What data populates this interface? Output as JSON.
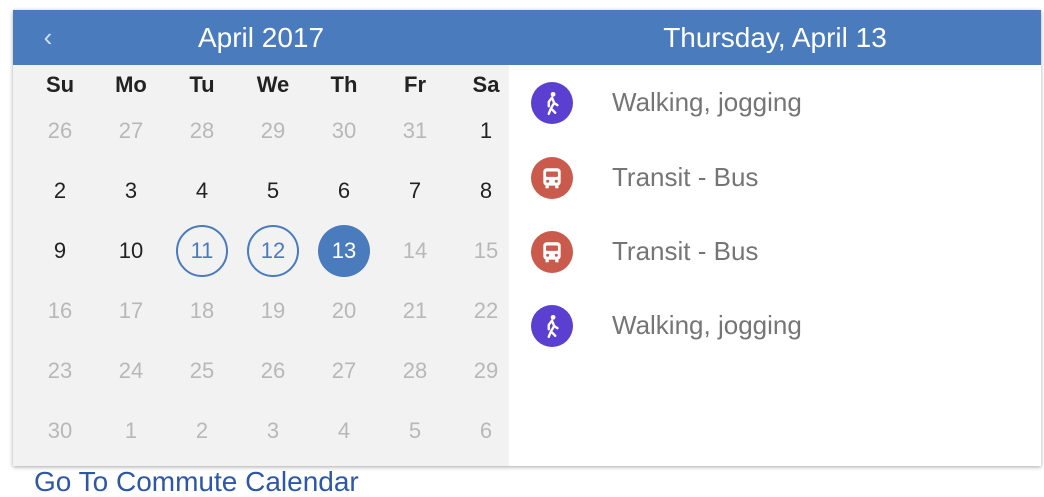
{
  "calendar": {
    "prev_icon": "chevron-left-icon",
    "month_title": "April 2017",
    "weekday_labels": [
      "Su",
      "Mo",
      "Tu",
      "We",
      "Th",
      "Fr",
      "Sa"
    ],
    "days": [
      {
        "label": "26",
        "state": "other"
      },
      {
        "label": "27",
        "state": "other"
      },
      {
        "label": "28",
        "state": "other"
      },
      {
        "label": "29",
        "state": "other"
      },
      {
        "label": "30",
        "state": "other"
      },
      {
        "label": "31",
        "state": "other"
      },
      {
        "label": "1",
        "state": "current"
      },
      {
        "label": "2",
        "state": "current"
      },
      {
        "label": "3",
        "state": "current"
      },
      {
        "label": "4",
        "state": "current"
      },
      {
        "label": "5",
        "state": "current"
      },
      {
        "label": "6",
        "state": "current"
      },
      {
        "label": "7",
        "state": "current"
      },
      {
        "label": "8",
        "state": "current"
      },
      {
        "label": "9",
        "state": "current"
      },
      {
        "label": "10",
        "state": "current"
      },
      {
        "label": "11",
        "state": "marked"
      },
      {
        "label": "12",
        "state": "marked"
      },
      {
        "label": "13",
        "state": "selected"
      },
      {
        "label": "14",
        "state": "future"
      },
      {
        "label": "15",
        "state": "future"
      },
      {
        "label": "16",
        "state": "future"
      },
      {
        "label": "17",
        "state": "future"
      },
      {
        "label": "18",
        "state": "future"
      },
      {
        "label": "19",
        "state": "future"
      },
      {
        "label": "20",
        "state": "future"
      },
      {
        "label": "21",
        "state": "future"
      },
      {
        "label": "22",
        "state": "future"
      },
      {
        "label": "23",
        "state": "future"
      },
      {
        "label": "24",
        "state": "future"
      },
      {
        "label": "25",
        "state": "future"
      },
      {
        "label": "26",
        "state": "future"
      },
      {
        "label": "27",
        "state": "future"
      },
      {
        "label": "28",
        "state": "future"
      },
      {
        "label": "29",
        "state": "future"
      },
      {
        "label": "30",
        "state": "future"
      },
      {
        "label": "1",
        "state": "other"
      },
      {
        "label": "2",
        "state": "other"
      },
      {
        "label": "3",
        "state": "other"
      },
      {
        "label": "4",
        "state": "other"
      },
      {
        "label": "5",
        "state": "other"
      },
      {
        "label": "6",
        "state": "other"
      }
    ]
  },
  "day_panel": {
    "title": "Thursday, April 13",
    "activities": [
      {
        "label": "Walking, jogging",
        "icon": "walking-icon",
        "color": "#5b3fd1"
      },
      {
        "label": "Transit - Bus",
        "icon": "bus-icon",
        "color": "#c95a4c"
      },
      {
        "label": "Transit - Bus",
        "icon": "bus-icon",
        "color": "#c95a4c"
      },
      {
        "label": "Walking, jogging",
        "icon": "walking-icon",
        "color": "#5b3fd1"
      }
    ]
  },
  "footer": {
    "link_label": "Go To Commute Calendar"
  },
  "colors": {
    "header": "#4a7bbd",
    "calendar_bg": "#f2f2f2",
    "link": "#2f57a8"
  }
}
